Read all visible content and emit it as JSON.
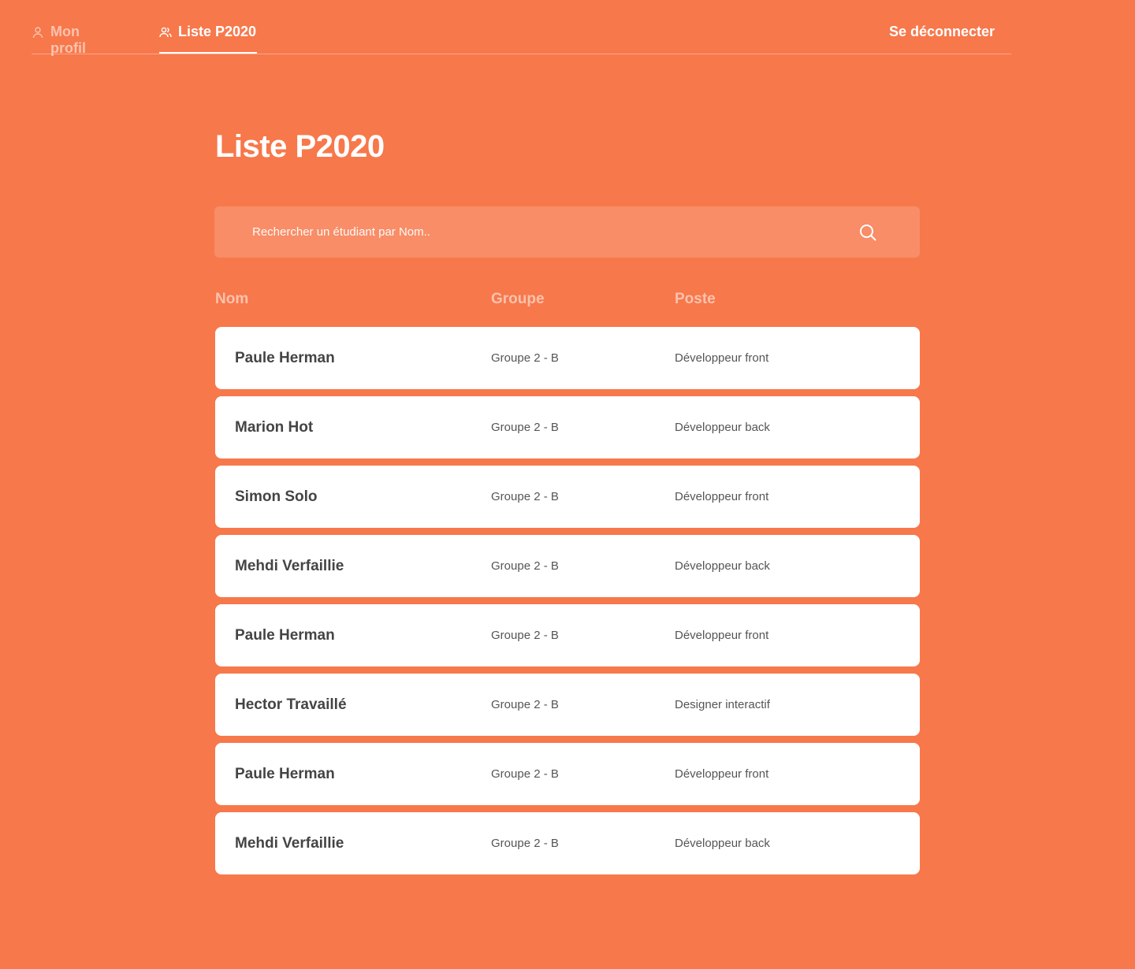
{
  "nav": {
    "tabs": [
      {
        "label": "Mon profil",
        "icon": "user-icon",
        "active": false
      },
      {
        "label": "Liste P2020",
        "icon": "users-icon",
        "active": true
      }
    ],
    "logout_label": "Se déconnecter"
  },
  "page": {
    "title": "Liste P2020"
  },
  "search": {
    "placeholder": "Rechercher un étudiant par Nom..",
    "icon": "search-icon"
  },
  "table": {
    "headers": {
      "nom": "Nom",
      "groupe": "Groupe",
      "poste": "Poste"
    },
    "rows": [
      {
        "nom": "Paule Herman",
        "groupe": "Groupe 2 - B",
        "poste": "Développeur front"
      },
      {
        "nom": "Marion Hot",
        "groupe": "Groupe 2 - B",
        "poste": "Développeur back"
      },
      {
        "nom": "Simon Solo",
        "groupe": "Groupe 2 - B",
        "poste": "Développeur front"
      },
      {
        "nom": "Mehdi Verfaillie",
        "groupe": "Groupe 2 - B",
        "poste": "Développeur back"
      },
      {
        "nom": "Paule Herman",
        "groupe": "Groupe 2 - B",
        "poste": "Développeur front"
      },
      {
        "nom": "Hector Travaillé",
        "groupe": "Groupe 2 - B",
        "poste": "Designer interactif"
      },
      {
        "nom": "Paule Herman",
        "groupe": "Groupe 2 - B",
        "poste": "Développeur front"
      },
      {
        "nom": "Mehdi Verfaillie",
        "groupe": "Groupe 2 - B",
        "poste": "Développeur back"
      }
    ]
  },
  "colors": {
    "background": "#f7784b",
    "card": "#ffffff",
    "name_text": "#444444",
    "cell_text": "#555555"
  }
}
